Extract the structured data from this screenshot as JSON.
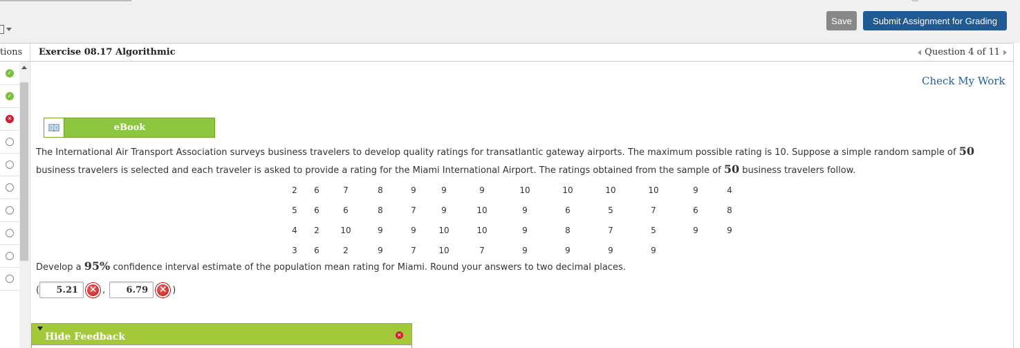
{
  "toolbar": {
    "save_label": "Save",
    "submit_label": "Submit Assignment for Grading",
    "colors": {
      "save_bg": "#888888",
      "submit_bg": "#1f5a94"
    }
  },
  "sidebar": {
    "header": "tions",
    "questions": [
      {
        "status": "correct",
        "icon": "check-icon"
      },
      {
        "status": "correct",
        "icon": "check-icon"
      },
      {
        "status": "incorrect",
        "icon": "x-icon"
      },
      {
        "status": "unanswered",
        "icon": "circle-icon"
      },
      {
        "status": "unanswered",
        "icon": "circle-icon"
      },
      {
        "status": "unanswered",
        "icon": "circle-icon"
      },
      {
        "status": "unanswered",
        "icon": "circle-icon"
      },
      {
        "status": "unanswered",
        "icon": "circle-icon"
      },
      {
        "status": "unanswered",
        "icon": "circle-icon"
      },
      {
        "status": "unanswered",
        "icon": "circle-icon"
      }
    ]
  },
  "header": {
    "exercise_title": "Exercise 08.17 Algorithmic",
    "question_nav": "Question 4 of 11"
  },
  "check_my_work": "Check My Work",
  "ebook_label": "eBook",
  "problem": {
    "sentence1_pre": "The International Air Transport Association surveys business travelers to develop quality ratings for transatlantic gateway airports. The maximum possible rating is 10. Suppose a simple random sample of ",
    "sample_n": "50",
    "sentence1_post": " business travelers is selected and each traveler is asked to provide a rating for the Miami International Airport. The ratings obtained from the sample of ",
    "sample_n2": "50",
    "sentence1_end": " business travelers follow.",
    "ratings": [
      [
        "2",
        "6",
        "7",
        "8",
        "9",
        "9",
        "9",
        "10",
        "10",
        "10",
        "10",
        "9",
        "4"
      ],
      [
        "5",
        "6",
        "6",
        "8",
        "7",
        "9",
        "10",
        "9",
        "6",
        "5",
        "7",
        "6",
        "8"
      ],
      [
        "4",
        "2",
        "10",
        "9",
        "9",
        "10",
        "10",
        "9",
        "8",
        "7",
        "5",
        "9",
        "9"
      ],
      [
        "3",
        "6",
        "2",
        "9",
        "7",
        "10",
        "7",
        "9",
        "9",
        "9",
        "9",
        "",
        ""
      ]
    ],
    "instruction_pre": "Develop a ",
    "confidence": "95%",
    "instruction_post": " confidence interval estimate of the population mean rating for Miami. Round your answers to two decimal places."
  },
  "answers": {
    "open_paren": "(",
    "lower": "5.21",
    "comma": ",",
    "upper": "6.79",
    "close_paren": ")"
  },
  "feedback": {
    "label": "Hide Feedback",
    "colors": {
      "bar_bg": "#a3c93a"
    }
  }
}
